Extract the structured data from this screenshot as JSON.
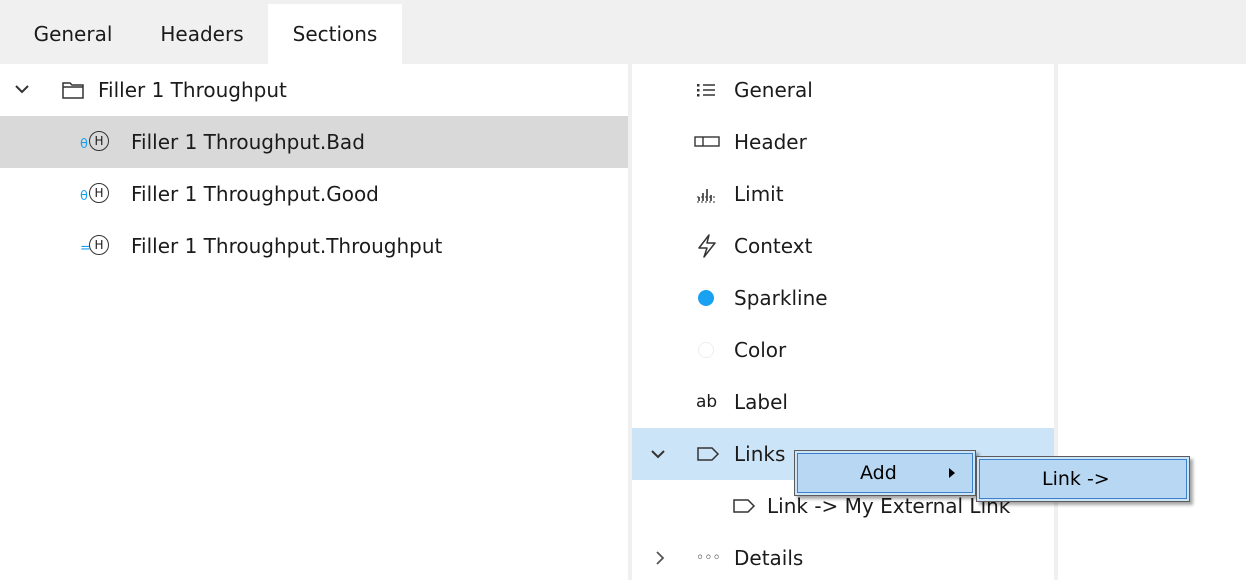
{
  "tabs": [
    {
      "label": "General"
    },
    {
      "label": "Headers"
    },
    {
      "label": "Sections",
      "active": true
    }
  ],
  "tree": {
    "root": {
      "label": "Filler 1 Throughput",
      "expanded": true
    },
    "children": [
      {
        "label": "Filler 1 Throughput.Bad",
        "badge": "θ",
        "selected": true
      },
      {
        "label": "Filler 1 Throughput.Good",
        "badge": "θ"
      },
      {
        "label": "Filler 1 Throughput.Throughput",
        "badge": "="
      }
    ],
    "node_glyph": "H"
  },
  "sections": {
    "items": [
      {
        "label": "General",
        "icon": "list-icon"
      },
      {
        "label": "Header",
        "icon": "header-icon"
      },
      {
        "label": "Limit",
        "icon": "limit-icon"
      },
      {
        "label": "Context",
        "icon": "lightning-icon"
      },
      {
        "label": "Sparkline",
        "icon": "dot-icon",
        "color": "#1ba1f2"
      },
      {
        "label": "Color",
        "icon": "circle-icon"
      },
      {
        "label": "Label",
        "icon": "ab-icon",
        "icon_text": "ab"
      },
      {
        "label": "Links",
        "icon": "tag-icon",
        "expanded": true
      },
      {
        "label": "Link -> My External Link",
        "icon": "tag-icon"
      },
      {
        "label": "Details",
        "icon": "dots-icon",
        "icon_text": "◦◦◦",
        "expanded": false
      }
    ]
  },
  "context_menu": {
    "add_label": "Add",
    "submenu_item": "Link ->"
  },
  "colors": {
    "tab_bar": "#f0f0f0",
    "selected_row": "#d9d9d9",
    "highlight_row": "#cce4f7",
    "accent": "#1ba1f2"
  }
}
